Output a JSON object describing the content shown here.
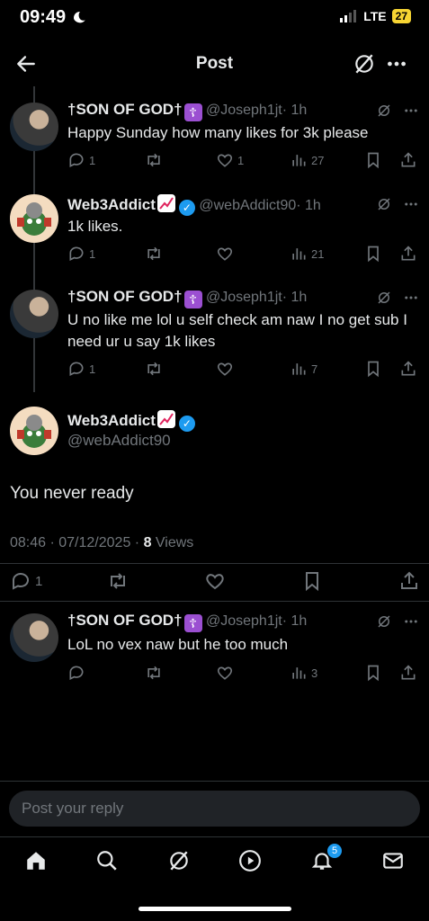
{
  "status_bar": {
    "time": "09:49",
    "network": "LTE",
    "battery": "27"
  },
  "header": {
    "title": "Post"
  },
  "replies_above": [
    {
      "name": "†SON OF GOD†",
      "handle": "@Joseph1jt",
      "time": "· 1h",
      "text": "Happy Sunday how many likes for 3k please",
      "replies": "1",
      "likes": "1",
      "views": "27"
    },
    {
      "name": "Web3Addict",
      "handle": "@webAddict90",
      "time": "· 1h",
      "text": "1k likes.",
      "replies": "1",
      "likes": "",
      "views": "21"
    },
    {
      "name": "†SON OF GOD†",
      "handle": "@Joseph1jt",
      "time": "· 1h",
      "text": "U no like me lol u self check am naw I no get sub I need ur u say 1k likes",
      "replies": "1",
      "likes": "",
      "views": "7"
    }
  ],
  "main_post": {
    "name": "Web3Addict",
    "handle": "@webAddict90",
    "text": "You never ready",
    "timestamp": "08:46 · 07/12/2025 · ",
    "views_count": "8",
    "views_label": " Views",
    "replies": "1"
  },
  "reply_below": {
    "name": "†SON OF GOD†",
    "handle": "@Joseph1jt",
    "time": "· 1h",
    "text": "LoL no vex naw but he too much",
    "views": "3"
  },
  "composer": {
    "placeholder": "Post your reply"
  },
  "bottom_nav": {
    "notifications_badge": "5"
  },
  "colors": {
    "background": "#000000",
    "text": "#e7e9ea",
    "muted": "#71767b",
    "accent": "#1d9bf0"
  },
  "icons": [
    "back-arrow-icon",
    "grok-icon",
    "more-icon",
    "reply-icon",
    "retweet-icon",
    "like-icon",
    "views-icon",
    "bookmark-icon",
    "share-icon",
    "verified-icon",
    "home-icon",
    "search-icon",
    "play-icon",
    "bell-icon",
    "mail-icon"
  ]
}
